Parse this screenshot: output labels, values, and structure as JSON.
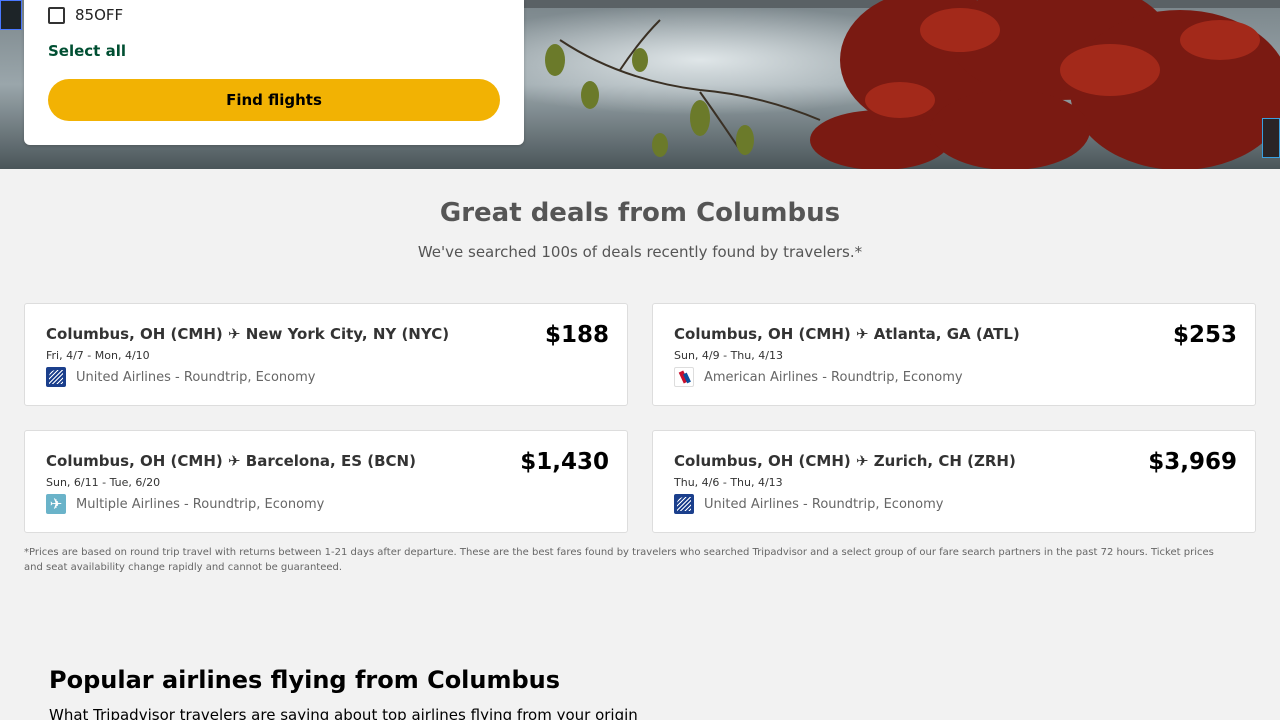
{
  "search_panel": {
    "promo_code": "85OFF",
    "select_all_label": "Select all",
    "find_flights_label": "Find flights"
  },
  "deals_section": {
    "title": "Great deals from Columbus",
    "subtitle": "We've searched 100s of deals recently found by travelers.*"
  },
  "deals": [
    {
      "route": "Columbus, OH (CMH) ✈ New York City, NY (NYC)",
      "dates": "Fri, 4/7 - Mon, 4/10",
      "airline": "United Airlines - Roundtrip, Economy",
      "price": "$188",
      "logo_icon": "united-airlines-logo"
    },
    {
      "route": "Columbus, OH (CMH) ✈ Atlanta, GA (ATL)",
      "dates": "Sun, 4/9 - Thu, 4/13",
      "airline": "American Airlines - Roundtrip, Economy",
      "price": "$253",
      "logo_icon": "american-airlines-logo"
    },
    {
      "route": "Columbus, OH (CMH) ✈ Barcelona, ES (BCN)",
      "dates": "Sun, 6/11 - Tue, 6/20",
      "airline": "Multiple Airlines - Roundtrip, Economy",
      "price": "$1,430",
      "logo_icon": "airplane-icon"
    },
    {
      "route": "Columbus, OH (CMH) ✈ Zurich, CH (ZRH)",
      "dates": "Thu, 4/6 - Thu, 4/13",
      "airline": "United Airlines - Roundtrip, Economy",
      "price": "$3,969",
      "logo_icon": "united-airlines-logo"
    }
  ],
  "disclaimer": "*Prices are based on round trip travel with returns between 1-21 days after departure. These are the best fares found by travelers who searched Tripadvisor and a select group of our fare search partners in the past 72 hours. Ticket prices and seat availability change rapidly and cannot be guaranteed.",
  "popular_airlines": {
    "title": "Popular airlines flying from Columbus",
    "subtitle": "What Tripadvisor travelers are saying about top airlines flying from your origin"
  },
  "colors": {
    "accent_button": "#f2b203",
    "link_green": "#004f32"
  }
}
